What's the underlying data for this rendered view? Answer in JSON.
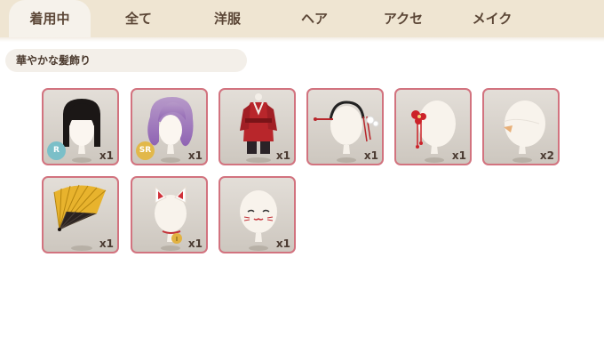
{
  "tabs": [
    {
      "label": "着用中",
      "active": true
    },
    {
      "label": "全て",
      "active": false
    },
    {
      "label": "洋服",
      "active": false
    },
    {
      "label": "ヘア",
      "active": false
    },
    {
      "label": "アクセ",
      "active": false
    },
    {
      "label": "メイク",
      "active": false
    }
  ],
  "category_label": "華やかな髪飾り",
  "items": [
    {
      "icon": "black-hime-cut-hair-icon",
      "quantity": "x1",
      "rarity": "R",
      "rarity_color": "#7bbfc8"
    },
    {
      "icon": "purple-wavy-hair-icon",
      "quantity": "x1",
      "rarity": "SR",
      "rarity_color": "#e2b84a"
    },
    {
      "icon": "red-kimono-outfit-icon",
      "quantity": "x1"
    },
    {
      "icon": "hair-pin-accessory-icon",
      "quantity": "x1"
    },
    {
      "icon": "red-flower-kanzashi-icon",
      "quantity": "x1"
    },
    {
      "icon": "hair-ornament-accessory-icon",
      "quantity": "x2"
    },
    {
      "icon": "golden-folding-fan-icon",
      "quantity": "x1"
    },
    {
      "icon": "lucky-cat-ears-icon",
      "quantity": "x1"
    },
    {
      "icon": "cat-whisker-makeup-icon",
      "quantity": "x1"
    }
  ],
  "colors": {
    "tabbar_bg": "#efe5d2",
    "card_border": "#d2737f",
    "text_brown": "#5b4636"
  }
}
